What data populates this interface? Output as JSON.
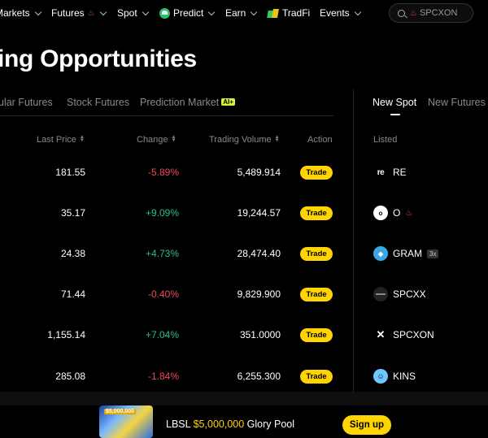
{
  "nav": {
    "items": [
      {
        "label": "Markets",
        "chevron": true
      },
      {
        "label": "Futures",
        "icon": "fire-icon",
        "chevron": true
      },
      {
        "label": "Spot",
        "chevron": true
      },
      {
        "label": "Predict",
        "icon": "predict-icon",
        "chevron": true
      },
      {
        "label": "Earn",
        "chevron": true
      },
      {
        "label": "TradFi",
        "icon": "tradfi-icon"
      },
      {
        "label": "Events",
        "chevron": true
      }
    ],
    "search": {
      "value": "SPCXON",
      "icon": "search-icon",
      "hot_icon": "fire-icon"
    }
  },
  "page": {
    "title": "ing Opportunities"
  },
  "tabs": [
    {
      "label": "ular Futures"
    },
    {
      "label": "Stock Futures"
    },
    {
      "label": "Prediction Market",
      "badge": "AI+"
    }
  ],
  "table": {
    "headers": {
      "price": "Last Price",
      "change": "Change",
      "volume": "Trading Volume",
      "action": "Action"
    },
    "rows": [
      {
        "price": "181.55",
        "change": "-5.89%",
        "dir": "neg",
        "volume": "5,489.914",
        "action": "Trade"
      },
      {
        "price": "35.17",
        "change": "+9.09%",
        "dir": "pos",
        "volume": "19,244.57",
        "action": "Trade"
      },
      {
        "price": "24.38",
        "change": "+4.73%",
        "dir": "pos",
        "volume": "28,474.40",
        "action": "Trade"
      },
      {
        "price": "71.44",
        "change": "-0.40%",
        "dir": "neg",
        "volume": "9,829.900",
        "action": "Trade"
      },
      {
        "price": "1,155.14",
        "change": "+7.04%",
        "dir": "pos",
        "volume": "351.0000",
        "action": "Trade"
      },
      {
        "price": "285.08",
        "change": "-1.84%",
        "dir": "neg",
        "volume": "6,255.300",
        "action": "Trade"
      }
    ]
  },
  "right_panel": {
    "tabs": [
      {
        "label": "New Spot",
        "active": true
      },
      {
        "label": "New Futures",
        "active": false
      }
    ],
    "header": "Listed",
    "coins": [
      {
        "symbol": "RE",
        "icon": "re-logo-icon",
        "icon_text": "re"
      },
      {
        "symbol": "O",
        "icon": "o-logo-icon",
        "icon_text": "o",
        "hot": true
      },
      {
        "symbol": "GRAM",
        "icon": "gram-logo-icon",
        "icon_text": "◆",
        "badge": "3x"
      },
      {
        "symbol": "SPCXX",
        "icon": "spcxx-logo-icon",
        "icon_text": ""
      },
      {
        "symbol": "SPCXON",
        "icon": "x-logo-icon",
        "icon_text": "✕"
      },
      {
        "symbol": "KINS",
        "icon": "kins-logo-icon",
        "icon_text": "☺"
      }
    ]
  },
  "promo": {
    "name": "LBSL",
    "amount": "$5,000,000",
    "suffix": "Glory Pool",
    "art_label": "$5,000,000",
    "button": "Sign up"
  },
  "colors": {
    "accent": "#ffd400",
    "negative": "#f0465a",
    "positive": "#2ebd85",
    "badge": "#d6f53b"
  }
}
